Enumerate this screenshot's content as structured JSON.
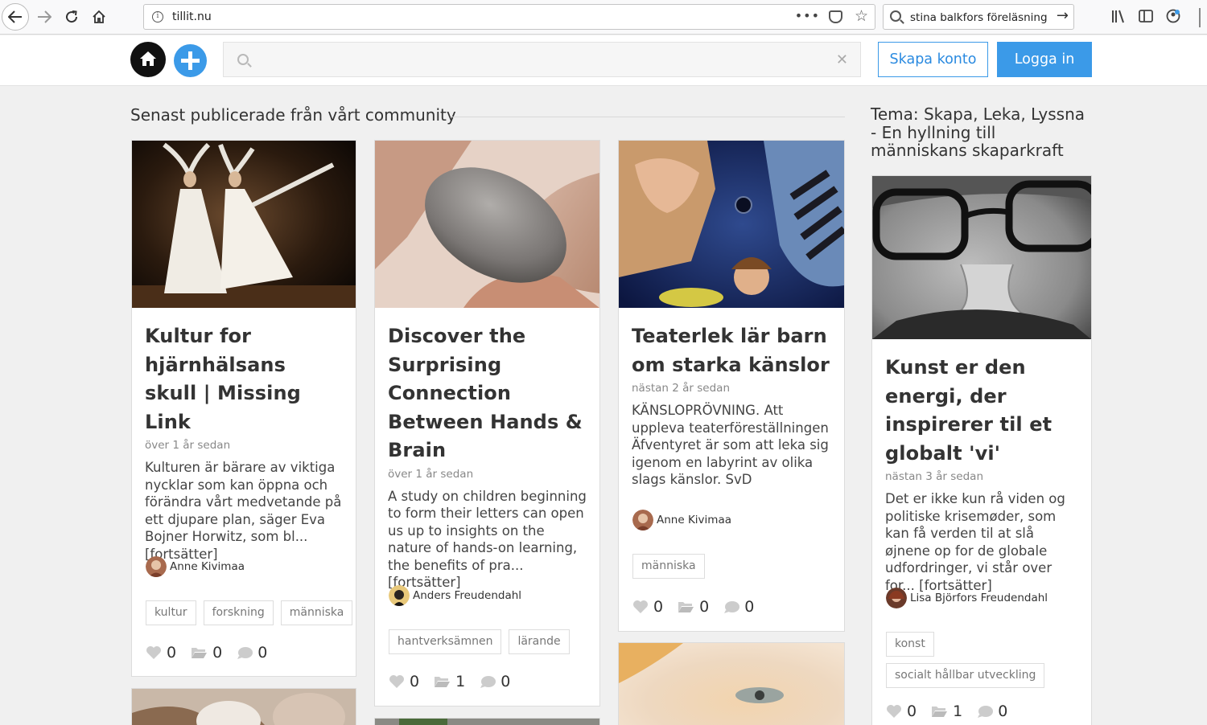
{
  "browser": {
    "url": "tillit.nu",
    "search_query": "stina balkfors föreläsning"
  },
  "header": {
    "create_account": "Skapa konto",
    "login": "Logga in"
  },
  "main": {
    "title": "Senast publicerade från vårt community"
  },
  "sidebar": {
    "title": "Tema: Skapa, Leka, Lyssna - En hyllning till människans skaparkraft"
  },
  "cards": [
    {
      "title": "Kultur for hjärnhälsans skull | Missing Link",
      "time": "över 1 år sedan",
      "excerpt": "Kulturen är bärare av viktiga nycklar som kan öppna och förändra vårt medvetande på ett djupare plan, säger Eva Bojner Horwitz, som bl... [fortsätter]",
      "author": "Anne Kivimaa",
      "tags": [
        "kultur",
        "forskning",
        "människa"
      ],
      "likes": "0",
      "collections": "0",
      "comments": "0"
    },
    {
      "title": "Discover the Surprising Connection Between Hands & Brain",
      "time": "över 1 år sedan",
      "excerpt": "A study on children beginning to form their letters can open us up to insights on the nature of hands-on learning, the benefits of pra... [fortsätter]",
      "author": "Anders Freudendahl",
      "tags": [
        "hantverksämnen",
        "lärande"
      ],
      "likes": "0",
      "collections": "1",
      "comments": "0"
    },
    {
      "title": "Teaterlek lär barn om starka känslor",
      "time": "nästan 2 år sedan",
      "excerpt": "KÄNSLOPRÖVNING. Att uppleva teaterföreställningen Äfventyret är som att leka sig igenom en labyrint av olika slags känslor. SvD",
      "author": "Anne Kivimaa",
      "tags": [
        "människa"
      ],
      "likes": "0",
      "collections": "0",
      "comments": "0"
    },
    {
      "title": "Kunst er den energi, der inspirerer til et globalt 'vi'",
      "time": "nästan 3 år sedan",
      "excerpt": "Det er ikke kun rå viden og politiske krisemøder, som kan få verden til at slå øjnene op for de globale udfordringer, vi står over for... [fortsätter]",
      "author": "Lisa Björfors Freudendahl",
      "tags": [
        "konst",
        "socialt hållbar utveckling"
      ],
      "likes": "0",
      "collections": "1",
      "comments": "0"
    }
  ]
}
